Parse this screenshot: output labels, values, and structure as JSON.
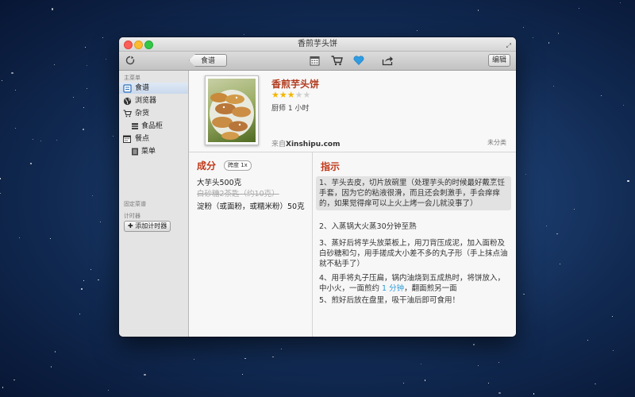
{
  "window": {
    "title": "香煎芋头饼"
  },
  "toolbar": {
    "back_label": "食谱",
    "edit_label": "编辑",
    "icons": [
      "sync-icon",
      "calendar-icon",
      "cart-icon",
      "heart-icon",
      "share-icon"
    ]
  },
  "sidebar": {
    "main_menu_header": "主菜单",
    "items": [
      {
        "label": "食谱",
        "icon": "recipe-book-icon",
        "active": true
      },
      {
        "label": "浏览器",
        "icon": "globe-icon"
      },
      {
        "label": "杂货",
        "icon": "cart-icon"
      },
      {
        "label": "食品柜",
        "icon": "pantry-icon",
        "sub": true
      },
      {
        "label": "餐点",
        "icon": "calendar-icon"
      },
      {
        "label": "菜单",
        "icon": "menu-icon",
        "sub": true
      }
    ],
    "pinned_header": "固定菜谱",
    "timers_header": "计时器",
    "add_timer_label": "✚ 添加计时器"
  },
  "recipe": {
    "title": "香煎芋头饼",
    "rating": 3,
    "rating_max": 5,
    "author": "厨师 1 小时",
    "source_prefix": "来自",
    "source": "Xinshipu.com",
    "category": "未分类"
  },
  "ingredients": {
    "title": "成分",
    "scale_label": "跨度 1x",
    "items": [
      {
        "text": "大芋头500克",
        "struck": false
      },
      {
        "text": "白砂糖2茶匙（约10克）",
        "struck": true
      },
      {
        "text": "淀粉（或面粉，或糯米粉）50克",
        "struck": false
      }
    ]
  },
  "instructions": {
    "title": "指示",
    "steps": [
      {
        "text": "1、芋头去皮，切片放碗里（处理芋头的时候最好戴烹饪手套，因为它的粘液很滑，而且还会刺激手，手会痒痒的，如果觉得痒可以上火上烤一会儿就没事了）",
        "highlighted": true
      },
      {
        "text": "2、入蒸锅大火蒸30分钟至熟"
      },
      {
        "text": "3、蒸好后将芋头放菜板上，用刀背压成泥，加入面粉及白砂糖和匀，用手搓成大小差不多的丸子形（手上抹点油就不粘手了）"
      },
      {
        "text_before": "4、用手将丸子压扁，锅内油烧到五成热时，将饼放入，中小火，一面煎约 ",
        "timer": "1 分钟",
        "text_after": "，翻面煎另一面"
      },
      {
        "text": "5、煎好后放在盘里，吸干油后即可食用！"
      }
    ]
  },
  "colors": {
    "accent_red": "#c0391b",
    "timer_blue": "#2c9ad8",
    "star_gold": "#f2b600"
  }
}
